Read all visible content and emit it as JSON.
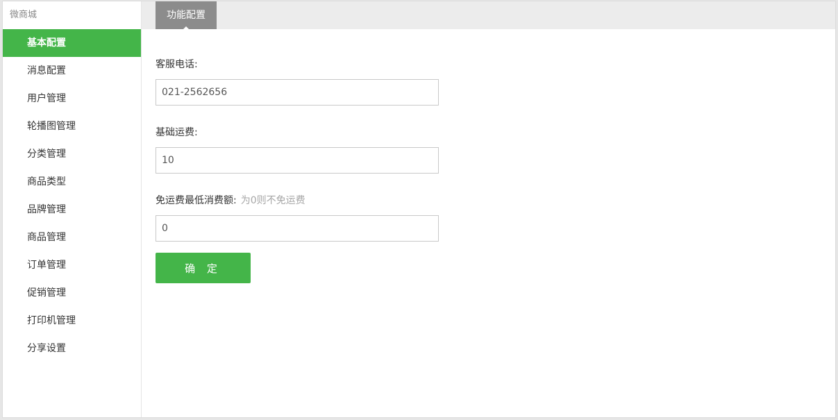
{
  "sidebar": {
    "title": "微商城",
    "items": [
      {
        "label": "基本配置",
        "active": true
      },
      {
        "label": "消息配置"
      },
      {
        "label": "用户管理"
      },
      {
        "label": "轮播图管理"
      },
      {
        "label": "分类管理"
      },
      {
        "label": "商品类型"
      },
      {
        "label": "品牌管理"
      },
      {
        "label": "商品管理"
      },
      {
        "label": "订单管理"
      },
      {
        "label": "促销管理"
      },
      {
        "label": "打印机管理"
      },
      {
        "label": "分享设置"
      }
    ]
  },
  "tabs": [
    {
      "label": "功能配置",
      "active": true
    }
  ],
  "form": {
    "phone": {
      "label": "客服电话:",
      "value": "021-2562656"
    },
    "base_freight": {
      "label": "基础运费:",
      "value": "10"
    },
    "free_freight_min": {
      "label": "免运费最低消费额:",
      "hint": "为0则不免运费",
      "value": "0"
    },
    "submit_label": "确 定"
  },
  "colors": {
    "accent": "#44b549",
    "tab_active": "#8c8c8c",
    "tabbar_bg": "#ececec"
  }
}
